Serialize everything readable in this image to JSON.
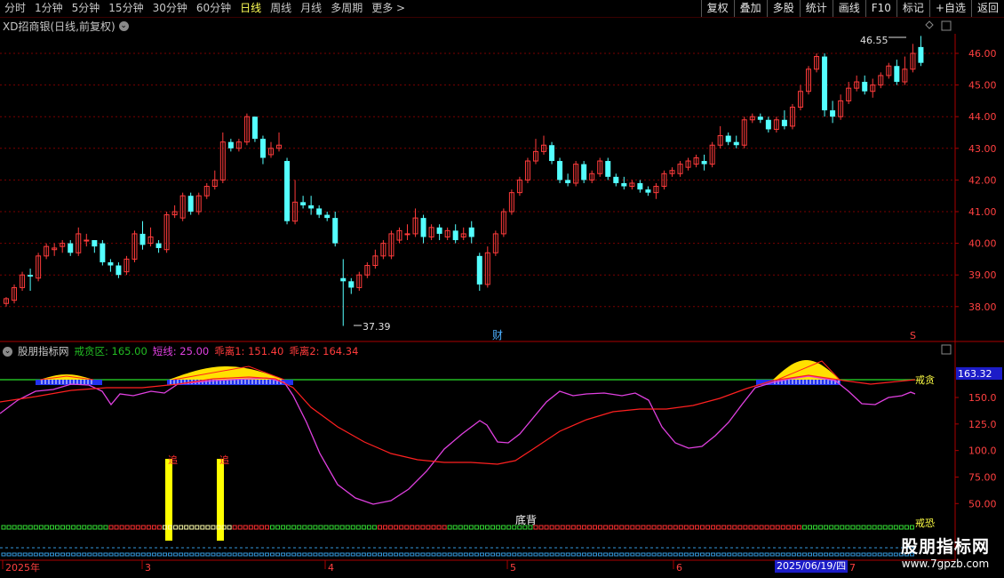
{
  "toolbar": {
    "left_items": [
      "分时",
      "1分钟",
      "5分钟",
      "15分钟",
      "30分钟",
      "60分钟",
      "日线",
      "周线",
      "月线",
      "多周期",
      "更多 >"
    ],
    "active": "日线",
    "right_items": [
      "复权",
      "叠加",
      "多股",
      "统计",
      "画线",
      "F10",
      "标记",
      "+自选",
      "返回"
    ]
  },
  "chart_title": "XD招商银(日线,前复权)",
  "price_axis": [
    "46.00",
    "45.00",
    "44.00",
    "43.00",
    "42.00",
    "41.00",
    "40.00",
    "39.00",
    "38.00"
  ],
  "max_label": "46.55",
  "min_label": "37.39",
  "fin_marker": "财",
  "s_marker": "S",
  "indicator": {
    "name": "股朋指标网",
    "items": [
      {
        "label": "戒贪区: 165.00",
        "color": "#22bb22"
      },
      {
        "label": "短线: 25.00",
        "color": "#e040e0"
      },
      {
        "label": "乖离1: 151.40",
        "color": "#ff3b3b"
      },
      {
        "label": "乖离2: 164.34",
        "color": "#ff3b3b"
      }
    ],
    "axis": [
      "150.0",
      "125.0",
      "100.0",
      "75.00",
      "50.00"
    ],
    "current_value": "163.32",
    "jietan": "戒贪",
    "jiekong": "戒恐",
    "dibei": "底背",
    "zhui": "追"
  },
  "date_axis": [
    "2025年",
    "3",
    "4",
    "5",
    "6",
    "7"
  ],
  "cursor_date": "2025/06/19/四",
  "brand": {
    "big": "股朋指标网",
    "small": "www.7gpzb.com"
  },
  "chart_data": {
    "type": "candlestick",
    "title": "XD招商银(日线,前复权)",
    "ylim": [
      37.2,
      46.9
    ],
    "colors": {
      "up": "#ff3b3b",
      "down": "#54ffff"
    },
    "candles": [
      [
        38.1,
        38.25,
        38.0,
        38.3
      ],
      [
        38.2,
        38.6,
        38.1,
        38.7
      ],
      [
        38.6,
        39.0,
        38.5,
        39.1
      ],
      [
        39.0,
        38.95,
        38.5,
        39.2
      ],
      [
        38.9,
        39.6,
        38.8,
        39.7
      ],
      [
        39.6,
        39.9,
        39.5,
        40.0
      ],
      [
        39.8,
        39.85,
        39.6,
        40.0
      ],
      [
        39.9,
        40.0,
        39.7,
        40.1
      ],
      [
        40.0,
        39.7,
        39.6,
        40.1
      ],
      [
        39.7,
        40.3,
        39.6,
        40.5
      ],
      [
        40.1,
        40.1,
        39.9,
        40.3
      ],
      [
        40.1,
        39.9,
        39.7,
        40.1
      ],
      [
        40.0,
        39.4,
        39.3,
        40.1
      ],
      [
        39.4,
        39.3,
        39.1,
        39.5
      ],
      [
        39.3,
        39.0,
        38.9,
        39.4
      ],
      [
        39.1,
        39.5,
        39.0,
        39.6
      ],
      [
        39.5,
        40.3,
        39.4,
        40.4
      ],
      [
        40.3,
        39.95,
        39.8,
        40.7
      ],
      [
        40.0,
        40.2,
        39.9,
        40.5
      ],
      [
        40.0,
        39.85,
        39.7,
        40.1
      ],
      [
        39.8,
        40.9,
        39.7,
        41.0
      ],
      [
        40.9,
        41.0,
        40.8,
        41.2
      ],
      [
        40.8,
        41.5,
        40.7,
        41.6
      ],
      [
        41.5,
        41.0,
        40.9,
        41.6
      ],
      [
        41.0,
        41.5,
        40.9,
        41.6
      ],
      [
        41.5,
        41.8,
        41.4,
        41.9
      ],
      [
        41.8,
        42.0,
        41.7,
        42.3
      ],
      [
        42.0,
        43.2,
        41.9,
        43.5
      ],
      [
        43.2,
        43.0,
        42.9,
        43.3
      ],
      [
        43.0,
        43.2,
        42.9,
        43.3
      ],
      [
        43.2,
        44.0,
        43.1,
        44.1
      ],
      [
        44.0,
        43.3,
        43.2,
        44.0
      ],
      [
        43.3,
        42.7,
        42.5,
        43.4
      ],
      [
        42.8,
        43.0,
        42.7,
        43.2
      ],
      [
        43.0,
        43.1,
        42.9,
        43.5
      ],
      [
        42.6,
        40.7,
        40.6,
        42.7
      ],
      [
        40.7,
        41.3,
        40.6,
        42.0
      ],
      [
        41.3,
        41.2,
        41.1,
        41.5
      ],
      [
        41.2,
        41.1,
        40.9,
        41.5
      ],
      [
        41.1,
        40.9,
        40.8,
        41.2
      ],
      [
        40.9,
        40.8,
        40.7,
        41.0
      ],
      [
        40.8,
        40.0,
        39.9,
        41.0
      ],
      [
        38.9,
        38.8,
        37.39,
        39.5
      ],
      [
        38.8,
        38.6,
        38.4,
        38.9
      ],
      [
        38.6,
        39.0,
        38.5,
        39.1
      ],
      [
        39.0,
        39.3,
        38.9,
        39.4
      ],
      [
        39.3,
        39.6,
        39.2,
        39.8
      ],
      [
        39.6,
        40.0,
        39.5,
        40.1
      ],
      [
        39.6,
        40.3,
        39.5,
        40.4
      ],
      [
        40.1,
        40.4,
        40.0,
        40.5
      ],
      [
        40.3,
        40.3,
        40.1,
        40.6
      ],
      [
        40.3,
        40.8,
        40.2,
        41.1
      ],
      [
        40.8,
        40.2,
        40.0,
        40.9
      ],
      [
        40.2,
        40.5,
        40.1,
        40.6
      ],
      [
        40.5,
        40.3,
        40.1,
        40.6
      ],
      [
        40.2,
        40.4,
        40.1,
        40.5
      ],
      [
        40.4,
        40.1,
        40.0,
        40.6
      ],
      [
        40.2,
        40.3,
        40.1,
        40.5
      ],
      [
        40.5,
        40.2,
        40.0,
        40.7
      ],
      [
        39.6,
        38.7,
        38.5,
        39.7
      ],
      [
        38.7,
        39.7,
        38.6,
        39.9
      ],
      [
        39.7,
        40.3,
        39.6,
        40.4
      ],
      [
        40.3,
        41.0,
        40.2,
        41.1
      ],
      [
        41.0,
        41.6,
        40.9,
        41.7
      ],
      [
        41.6,
        42.0,
        41.5,
        42.1
      ],
      [
        42.0,
        42.6,
        41.9,
        42.7
      ],
      [
        42.6,
        42.9,
        42.5,
        43.3
      ],
      [
        42.9,
        43.1,
        42.8,
        43.4
      ],
      [
        43.1,
        42.6,
        42.5,
        43.2
      ],
      [
        42.6,
        42.0,
        41.9,
        42.7
      ],
      [
        42.0,
        41.9,
        41.8,
        42.2
      ],
      [
        41.9,
        42.5,
        41.8,
        42.6
      ],
      [
        42.5,
        42.0,
        41.9,
        42.6
      ],
      [
        42.0,
        42.2,
        41.9,
        42.3
      ],
      [
        42.2,
        42.6,
        42.1,
        42.7
      ],
      [
        42.6,
        42.1,
        42.0,
        42.7
      ],
      [
        42.1,
        41.9,
        41.8,
        42.2
      ],
      [
        41.9,
        41.8,
        41.7,
        42.1
      ],
      [
        41.8,
        41.9,
        41.7,
        42.0
      ],
      [
        41.9,
        41.7,
        41.6,
        42.0
      ],
      [
        41.7,
        41.6,
        41.5,
        41.8
      ],
      [
        41.6,
        41.8,
        41.4,
        41.9
      ],
      [
        41.8,
        42.2,
        41.7,
        42.3
      ],
      [
        42.2,
        42.3,
        42.1,
        42.4
      ],
      [
        42.2,
        42.5,
        42.1,
        42.6
      ],
      [
        42.4,
        42.6,
        42.3,
        42.7
      ],
      [
        42.5,
        42.7,
        42.4,
        42.8
      ],
      [
        42.6,
        42.5,
        42.3,
        42.8
      ],
      [
        42.5,
        43.1,
        42.4,
        43.2
      ],
      [
        43.1,
        43.4,
        43.0,
        43.7
      ],
      [
        43.4,
        43.2,
        43.1,
        43.5
      ],
      [
        43.2,
        43.1,
        43.0,
        43.4
      ],
      [
        43.1,
        43.9,
        43.0,
        44.0
      ],
      [
        43.9,
        44.0,
        43.8,
        44.1
      ],
      [
        44.0,
        43.9,
        43.8,
        44.1
      ],
      [
        43.9,
        43.6,
        43.5,
        44.0
      ],
      [
        43.6,
        43.9,
        43.5,
        44.0
      ],
      [
        43.9,
        43.7,
        43.6,
        44.2
      ],
      [
        43.7,
        44.3,
        43.6,
        44.4
      ],
      [
        44.3,
        44.8,
        44.2,
        45.0
      ],
      [
        44.8,
        45.5,
        44.7,
        45.6
      ],
      [
        45.5,
        45.9,
        45.4,
        46.0
      ],
      [
        45.9,
        44.2,
        44.0,
        46.0
      ],
      [
        44.2,
        44.0,
        43.8,
        44.5
      ],
      [
        44.0,
        44.5,
        43.9,
        44.7
      ],
      [
        44.5,
        44.9,
        44.4,
        45.1
      ],
      [
        44.9,
        45.1,
        44.8,
        45.3
      ],
      [
        45.1,
        44.8,
        44.7,
        45.3
      ],
      [
        44.8,
        45.0,
        44.6,
        45.2
      ],
      [
        45.0,
        45.3,
        44.9,
        45.4
      ],
      [
        45.3,
        45.6,
        45.2,
        45.7
      ],
      [
        45.6,
        45.1,
        45.0,
        45.8
      ],
      [
        45.1,
        45.5,
        45.0,
        45.9
      ],
      [
        45.5,
        46.0,
        45.4,
        46.3
      ],
      [
        46.2,
        45.7,
        45.6,
        46.55
      ]
    ]
  }
}
